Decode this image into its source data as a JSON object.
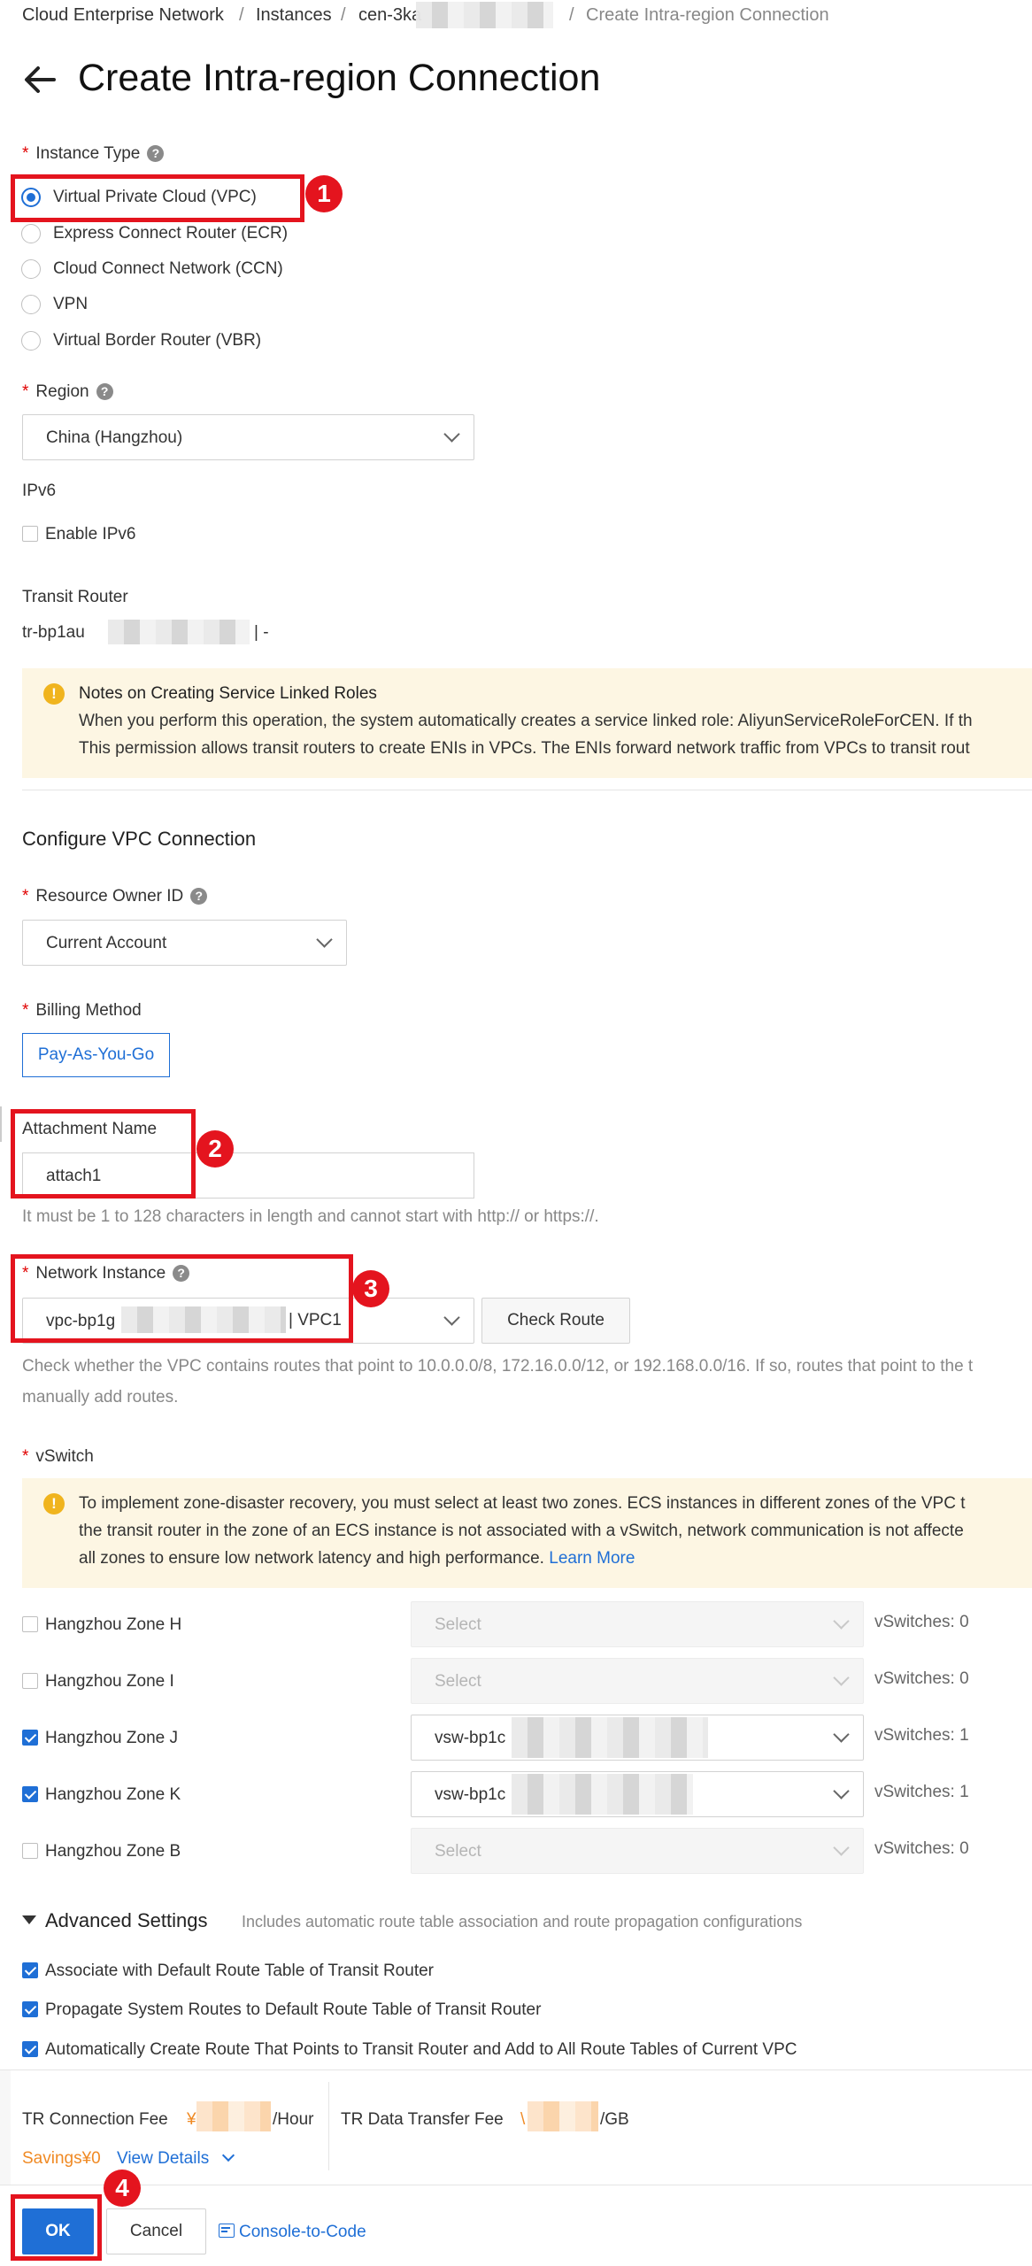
{
  "breadcrumb": {
    "items": [
      "Cloud Enterprise Network",
      "Instances",
      "cen-3ka",
      "Create Intra-region Connection"
    ],
    "separator": "/"
  },
  "page": {
    "title": "Create Intra-region Connection"
  },
  "instance_type": {
    "label": "Instance Type",
    "options": [
      "Virtual Private Cloud (VPC)",
      "Express Connect Router (ECR)",
      "Cloud Connect Network (CCN)",
      "VPN",
      "Virtual Border Router (VBR)"
    ],
    "selected": "Virtual Private Cloud (VPC)"
  },
  "region": {
    "label": "Region",
    "value": "China (Hangzhou)"
  },
  "ipv6": {
    "label": "IPv6",
    "checkbox_label": "Enable IPv6",
    "checked": false
  },
  "transit_router": {
    "label": "Transit Router",
    "value_prefix": "tr-bp1au",
    "value_suffix": "| -"
  },
  "notice": {
    "title": "Notes on Creating Service Linked Roles",
    "line1": "When you perform this operation, the system automatically creates a service linked role: AliyunServiceRoleForCEN. If th",
    "line2": "This permission allows transit routers to create ENIs in VPCs. The ENIs forward network traffic from VPCs to transit rout"
  },
  "vpc_section": {
    "title": "Configure VPC Connection"
  },
  "resource_owner": {
    "label": "Resource Owner ID",
    "value": "Current Account"
  },
  "billing": {
    "label": "Billing Method",
    "value": "Pay-As-You-Go"
  },
  "attachment": {
    "label": "Attachment Name",
    "value": "attach1",
    "hint": "It must be 1 to 128 characters in length and cannot start with http:// or https://."
  },
  "network_instance": {
    "label": "Network Instance",
    "value_prefix": "vpc-bp1g",
    "value_suffix": "| VPC1",
    "check_route_label": "Check Route",
    "hint_line1": "Check whether the VPC contains routes that point to 10.0.0.0/8, 172.16.0.0/12, or 192.168.0.0/16. If so, routes that point to the t",
    "hint_line2": "manually add routes."
  },
  "vswitch": {
    "label": "vSwitch",
    "notice_line1": "To implement zone-disaster recovery, you must select at least two zones. ECS instances in different zones of the VPC t",
    "notice_line2": "the transit router in the zone of an ECS instance is not associated with a vSwitch, network communication is not affecte",
    "notice_line3": "all zones to ensure low network latency and high performance.",
    "learn_more": "Learn More",
    "zones": [
      {
        "name": "Hangzhou Zone H",
        "checked": false,
        "select": "Select",
        "count": "vSwitches: 0",
        "disabled": true
      },
      {
        "name": "Hangzhou Zone I",
        "checked": false,
        "select": "Select",
        "count": "vSwitches: 0",
        "disabled": true
      },
      {
        "name": "Hangzhou Zone J",
        "checked": true,
        "select": "vsw-bp1c",
        "count": "vSwitches: 1",
        "disabled": false
      },
      {
        "name": "Hangzhou Zone K",
        "checked": true,
        "select": "vsw-bp1c",
        "count": "vSwitches: 1",
        "disabled": false
      },
      {
        "name": "Hangzhou Zone B",
        "checked": false,
        "select": "Select",
        "count": "vSwitches: 0",
        "disabled": true
      }
    ]
  },
  "advanced": {
    "title": "Advanced Settings",
    "subtitle": "Includes automatic route table association and route propagation configurations",
    "options": [
      "Associate with Default Route Table of Transit Router",
      "Propagate System Routes to Default Route Table of Transit Router",
      "Automatically Create Route That Points to Transit Router and Add to All Route Tables of Current VPC"
    ]
  },
  "fees": {
    "tr_connection_label": "TR Connection Fee",
    "tr_connection_currency": "¥",
    "tr_connection_unit": "/Hour",
    "tr_data_label": "TR Data Transfer Fee",
    "tr_data_currency": "\\",
    "tr_data_unit": "/GB",
    "savings": "Savings¥0",
    "view_details": "View Details"
  },
  "footer": {
    "ok": "OK",
    "cancel": "Cancel",
    "console_to_code": "Console-to-Code"
  },
  "annotations": [
    "1",
    "2",
    "3",
    "4"
  ],
  "colors": {
    "accent": "#1f6fd6",
    "annotation": "#e4141e",
    "warning_bg": "#fdf6e3",
    "savings": "#f08a24"
  }
}
